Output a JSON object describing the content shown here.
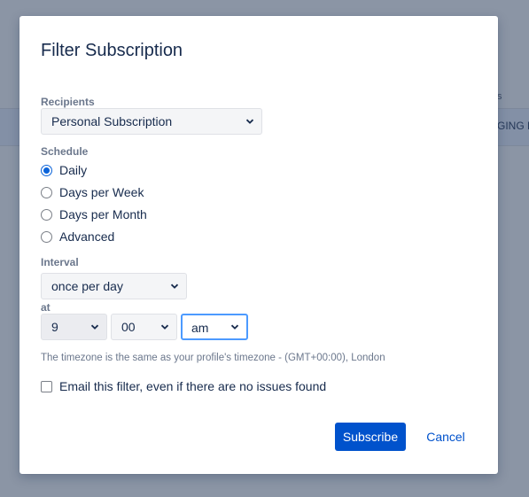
{
  "background": {
    "header_fragment": "s",
    "band_text": "GING R"
  },
  "dialog": {
    "title": "Filter Subscription",
    "recipients": {
      "label": "Recipients",
      "selected": "Personal Subscription"
    },
    "schedule": {
      "label": "Schedule",
      "options": [
        {
          "label": "Daily",
          "checked": true
        },
        {
          "label": "Days per Week",
          "checked": false
        },
        {
          "label": "Days per Month",
          "checked": false
        },
        {
          "label": "Advanced",
          "checked": false
        }
      ]
    },
    "interval": {
      "label": "Interval",
      "selected": "once per day"
    },
    "at": {
      "label": "at",
      "hour": "9",
      "minute": "00",
      "meridiem": "am"
    },
    "timezone_note": "The timezone is the same as your profile's timezone - (GMT+00:00), London",
    "email_empty": {
      "label": "Email this filter, even if there are no issues found",
      "checked": false
    },
    "buttons": {
      "subscribe": "Subscribe",
      "cancel": "Cancel"
    }
  },
  "colors": {
    "primary": "#0052cc",
    "focus_ring": "#4c9aff",
    "overlay": "#8b95a5"
  }
}
